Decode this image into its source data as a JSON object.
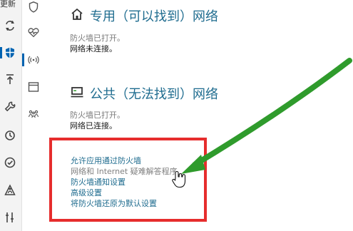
{
  "sidebar_outer": {
    "top_clip_text": "更新",
    "icons": [
      "refresh-icon",
      "shield-icon",
      "upload-icon",
      "wrench-icon",
      "history-icon",
      "check-circle-icon",
      "person-warning-icon",
      "sliders-icon"
    ]
  },
  "sidebar_inner": {
    "icons": [
      "shield-outline-icon",
      "heart-pulse-icon",
      "wireless-icon",
      "browser-window-icon",
      "family-icon"
    ]
  },
  "networks": [
    {
      "title": "专用（可以找到）网络",
      "status_firewall": "防火墙已打开。",
      "status_connection": "网络未连接。"
    },
    {
      "title": "公共（无法找到）网络",
      "status_firewall": "防火墙已打开。",
      "status_connection": "网络已连接。"
    }
  ],
  "links": [
    {
      "label": "允许应用通过防火墙",
      "enabled": true
    },
    {
      "label": "网络和 Internet 疑难解答程序",
      "enabled": false
    },
    {
      "label": "防火墙通知设置",
      "enabled": true
    },
    {
      "label": "高级设置",
      "enabled": true
    },
    {
      "label": "将防火墙还原为默认设置",
      "enabled": true
    }
  ],
  "colors": {
    "accent": "#0063b1",
    "link": "#1f6c8f",
    "highlight_box": "#e62d2d",
    "annotation_arrow": "#2f9b2c"
  }
}
